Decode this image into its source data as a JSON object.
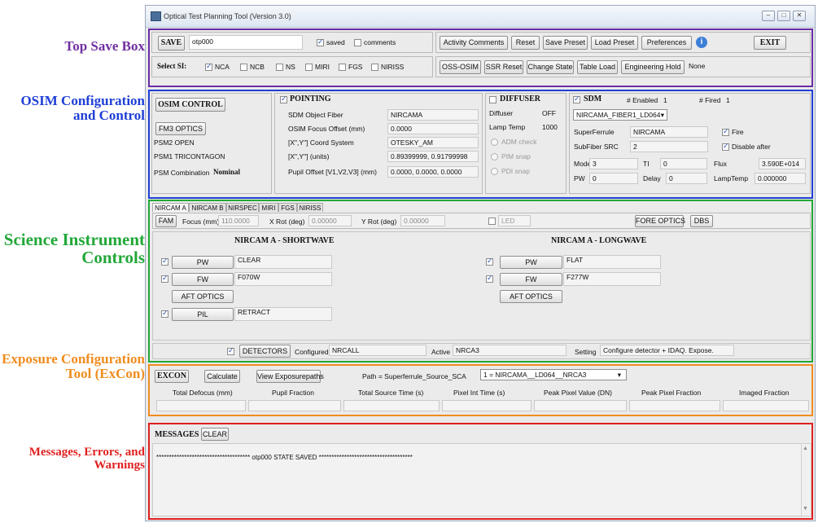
{
  "window": {
    "title": "Optical Test Planning Tool  (Version 3.0)"
  },
  "annotations": {
    "top_save": "Top Save Box",
    "osim": "OSIM Configuration and Control",
    "si": "Science Instrument Controls",
    "excon": "Exposure Configuration Tool (ExCon)",
    "messages": "Messages, Errors, and Warnings",
    "colors": {
      "top_save": "#7030a0",
      "osim": "#1f3fd6",
      "si": "#22a838",
      "excon": "#f08c1e",
      "messages": "#e02020"
    }
  },
  "save_box": {
    "save_label": "SAVE",
    "filename": "otp000",
    "saved_label": "saved",
    "comments_label": "comments",
    "buttons": [
      "Activity Comments",
      "Reset",
      "Save Preset",
      "Load Preset",
      "Preferences"
    ],
    "exit_label": "EXIT",
    "select_si_label": "Select SI:",
    "si_options": [
      "NCA",
      "NCB",
      "NS",
      "MIRI",
      "FGS",
      "NIRISS"
    ],
    "row2_buttons": [
      "OSS-OSIM",
      "SSR Reset",
      "Change State",
      "Table Load",
      "Engineering Hold"
    ],
    "hold_status": "None"
  },
  "osim": {
    "control_label": "OSIM CONTROL",
    "fm3_label": "FM3 OPTICS",
    "psm2": "PSM2  OPEN",
    "psm1": "PSM1  TRICONTAGON",
    "psm_combo_label": "PSM Combination",
    "psm_combo_value": "Nominal",
    "pointing_label": "POINTING",
    "pointing_rows": [
      {
        "label": "SDM Object Fiber",
        "value": "NIRCAMA"
      },
      {
        "label": "OSIM Focus Offset (mm)",
        "value": "0.0000"
      },
      {
        "label": "[X\",Y\"] Coord System",
        "value": "OTESKY_AM"
      },
      {
        "label": "[X\",Y\"] (units)",
        "value": "0.89399999, 0.91799998"
      },
      {
        "label": "Pupil Offset [V1,V2,V3] (mm)",
        "value": "0.0000, 0.0000, 0.0000"
      }
    ],
    "diffuser_label": "DIFFUSER",
    "diffuser_name": "Diffuser",
    "diffuser_value": "OFF",
    "lamp_temp_label": "Lamp Temp",
    "lamp_temp_value": "1000",
    "snaps": [
      "ADM check",
      "PIM snap",
      "PDI snap"
    ],
    "sdm_label": "SDM",
    "enabled_label": "# Enabled",
    "enabled_value": "1",
    "fired_label": "# Fired",
    "fired_value": "1",
    "fiber_select": "NIRCAMA_FIBER1_LD064",
    "superferrule_label": "SuperFerrule",
    "superferrule_value": "NIRCAMA",
    "subfiber_label": "SubFiber SRC",
    "subfiber_value": "2",
    "fire_label": "Fire",
    "disable_after_label": "Disable after",
    "mode_label": "Mode",
    "mode_value": "3",
    "ti_label": "TI",
    "ti_value": "0",
    "flux_label": "Flux",
    "flux_value": "3.590E+014",
    "pw_label": "PW",
    "pw_value": "0",
    "delay_label": "Delay",
    "delay_value": "0",
    "lamptemp2_label": "LampTemp",
    "lamptemp2_value": "0.000000"
  },
  "si": {
    "tabs": [
      "NIRCAM A",
      "NIRCAM B",
      "NIRSPEC",
      "MIRI",
      "FGS",
      "NIRISS"
    ],
    "fam_label": "FAM",
    "focus_label": "Focus (mm)",
    "focus_value": "110.0000",
    "xrot_label": "X Rot (deg)",
    "xrot_value": "0.00000",
    "yrot_label": "Y Rot (deg)",
    "yrot_value": "0.00000",
    "led_label": "LED",
    "fore_optics_label": "FORE OPTICS",
    "dbs_label": "DBS",
    "shortwave_title": "NIRCAM A - SHORTWAVE",
    "longwave_title": "NIRCAM A - LONGWAVE",
    "sw": {
      "pw": "PW",
      "pw_value": "CLEAR",
      "fw": "FW",
      "fw_value": "F070W",
      "aft": "AFT OPTICS",
      "pil": "PIL",
      "pil_value": "RETRACT"
    },
    "lw": {
      "pw": "PW",
      "pw_value": "FLAT",
      "fw": "FW",
      "fw_value": "F277W",
      "aft": "AFT OPTICS"
    },
    "detectors_label": "DETECTORS",
    "configured_label": "Configured",
    "configured_value": "NRCALL",
    "active_label": "Active",
    "active_value": "NRCA3",
    "setting_label": "Setting",
    "setting_value": "Configure detector + IDAQ. Expose."
  },
  "excon": {
    "label": "EXCON",
    "calculate": "Calculate",
    "view_paths": "View Exposurepaths",
    "path_label": "Path = Superferrule_Source_SCA",
    "path_select": "1 = NIRCAMA__LD064__NRCA3",
    "columns": [
      "Total Defocus (mm)",
      "Pupil Fraction",
      "Total Source Time (s)",
      "Pixel Int Time (s)",
      "Peak Pixel Value (DN)",
      "Peak Pixel Fraction",
      "Imaged Fraction"
    ]
  },
  "messages": {
    "label": "MESSAGES",
    "clear": "CLEAR",
    "log": "*************************************  otp000 STATE SAVED  *************************************"
  }
}
